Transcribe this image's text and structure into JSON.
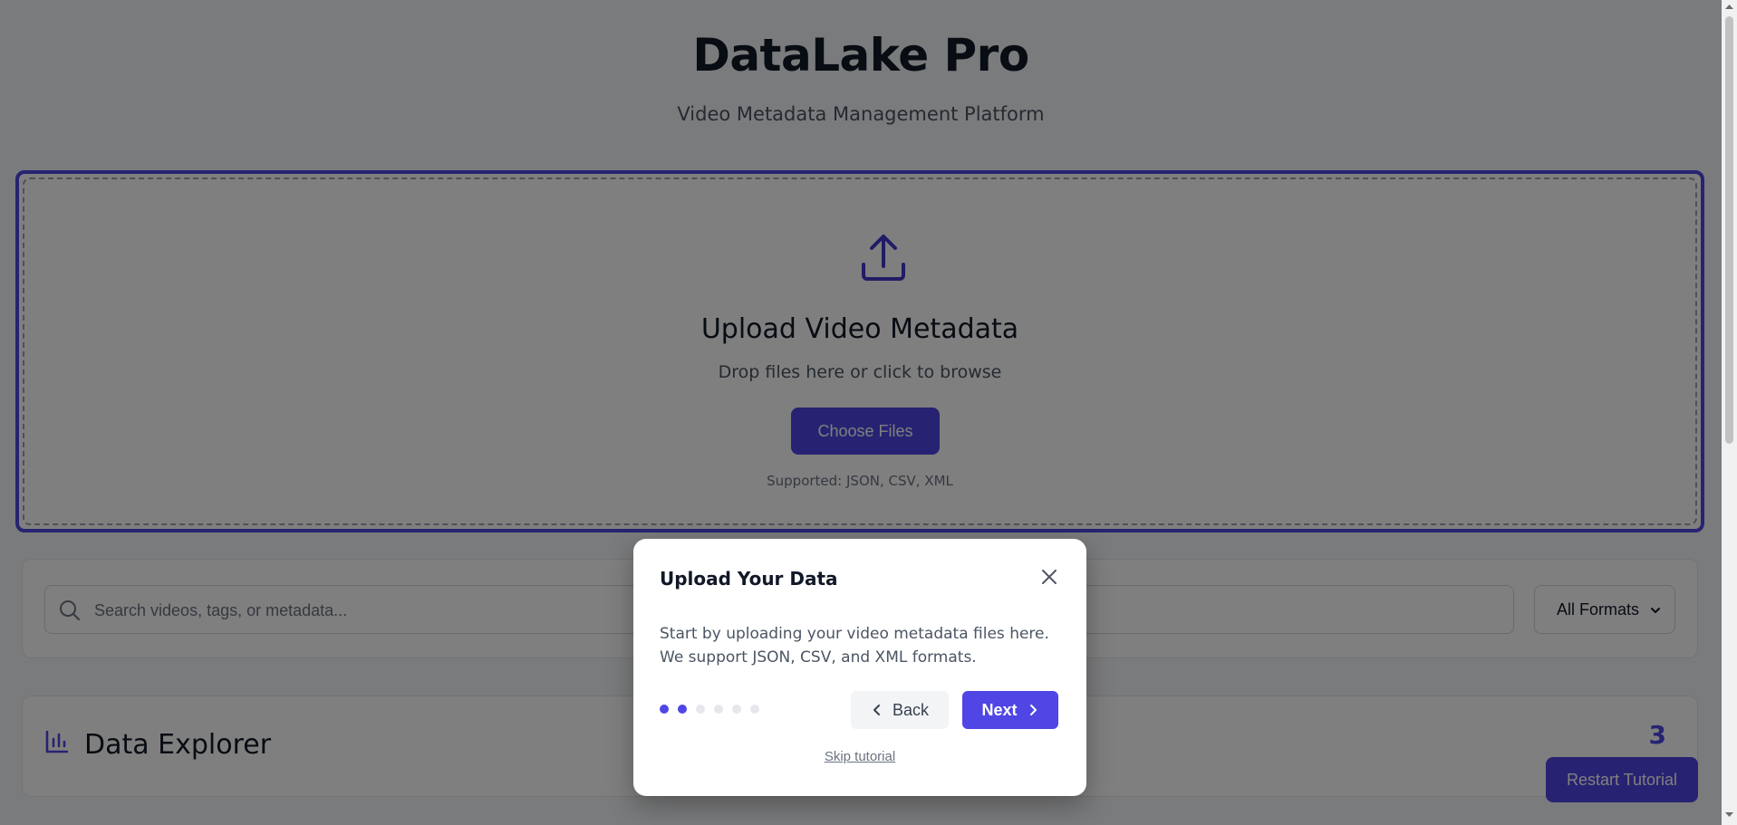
{
  "header": {
    "title": "DataLake Pro",
    "subtitle": "Video Metadata Management Platform"
  },
  "upload": {
    "icon": "upload-icon",
    "title": "Upload Video Metadata",
    "hint": "Drop files here or click to browse",
    "button_label": "Choose Files",
    "supported": "Supported: JSON, CSV, XML"
  },
  "search": {
    "icon": "search-icon",
    "placeholder": "Search videos, tags, or metadata...",
    "value": "",
    "format_selected": "All Formats"
  },
  "explorer": {
    "icon": "bar-chart-icon",
    "title": "Data Explorer",
    "count": "3",
    "restart_label": "Restart Tutorial"
  },
  "tutorial": {
    "title": "Upload Your Data",
    "body": "Start by uploading your video metadata files here. We support JSON, CSV, and XML formats.",
    "step": 2,
    "total_steps": 6,
    "back_label": "Back",
    "next_label": "Next",
    "skip_label": "Skip tutorial"
  },
  "colors": {
    "accent": "#4f46e5",
    "overlay": "rgba(0,0,0,0.5)"
  }
}
